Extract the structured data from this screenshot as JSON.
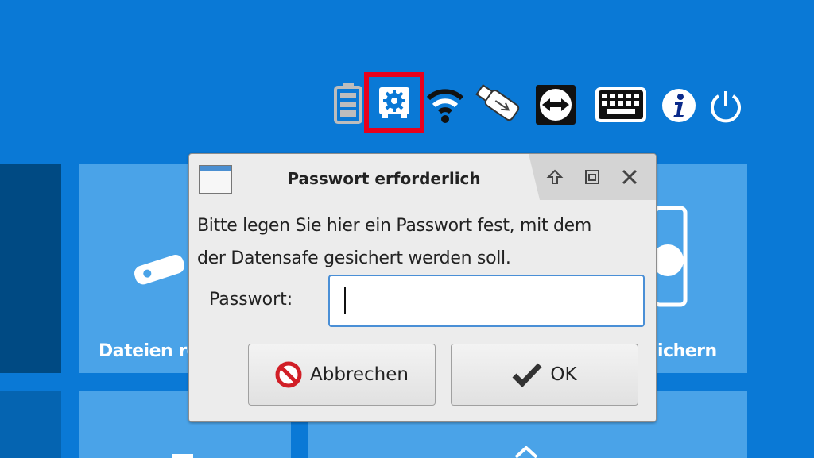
{
  "tiles": {
    "left_label": "Dateien re",
    "right_label": "ichern"
  },
  "status_icons": [
    {
      "name": "battery-icon"
    },
    {
      "name": "datasafe-settings-icon",
      "highlighted": true
    },
    {
      "name": "wifi-icon"
    },
    {
      "name": "usb-stick-icon"
    },
    {
      "name": "teamviewer-icon"
    },
    {
      "name": "keyboard-icon"
    },
    {
      "name": "info-icon"
    },
    {
      "name": "power-icon"
    }
  ],
  "colors": {
    "background": "#0a79d6",
    "highlight": "#e8001c",
    "input_focus": "#4a8fd6",
    "cancel_icon": "#d11f27"
  },
  "dialog": {
    "title": "Passwort erforderlich",
    "message_line1": "Bitte legen Sie hier ein Passwort fest, mit dem",
    "message_line2": "der Datensafe gesichert werden soll.",
    "password_label": "Passwort:",
    "password_value": "",
    "cancel_label": "Abbrechen",
    "ok_label": "OK"
  }
}
